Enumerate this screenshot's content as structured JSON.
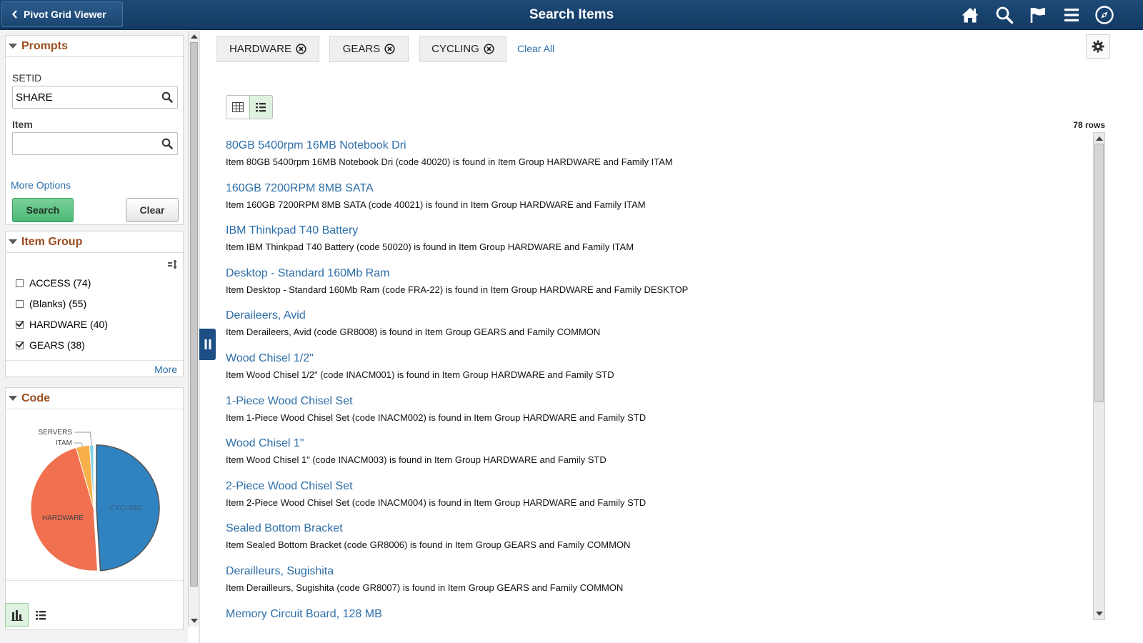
{
  "header": {
    "back_label": "Pivot Grid Viewer",
    "title": "Search Items"
  },
  "prompts": {
    "title": "Prompts",
    "setid_label": "SETID",
    "setid_value": "SHARE",
    "item_label": "Item",
    "item_value": "",
    "more_options": "More Options",
    "search_label": "Search",
    "clear_label": "Clear"
  },
  "item_group": {
    "title": "Item Group",
    "facets": [
      {
        "label": "ACCESS (74)",
        "checked": false
      },
      {
        "label": "(Blanks) (55)",
        "checked": false
      },
      {
        "label": "HARDWARE (40)",
        "checked": true
      },
      {
        "label": "GEARS (38)",
        "checked": true
      }
    ],
    "more": "More"
  },
  "code": {
    "title": "Code",
    "chart_data": {
      "type": "pie",
      "title": "Code",
      "slices": [
        {
          "label": "CYCLING",
          "value": 49,
          "color": "#2f83c0"
        },
        {
          "label": "HARDWARE",
          "value": 46.5,
          "color": "#f07050"
        },
        {
          "label": "ITAM",
          "value": 3.5,
          "color": "#f7b04a"
        },
        {
          "label": "SERVERS",
          "value": 1,
          "color": "#7fd0e2"
        }
      ]
    }
  },
  "filters": {
    "chips": [
      "HARDWARE",
      "GEARS",
      "CYCLING"
    ],
    "clear_all": "Clear All"
  },
  "results": {
    "rows_count": "78 rows",
    "items": [
      {
        "title": "80GB 5400rpm 16MB Notebook Dri",
        "desc": "Item 80GB 5400rpm 16MB Notebook Dri (code 40020) is found in Item Group HARDWARE and Family ITAM"
      },
      {
        "title": "160GB 7200RPM 8MB SATA",
        "desc": "Item 160GB 7200RPM 8MB SATA (code 40021) is found in Item Group HARDWARE and Family ITAM"
      },
      {
        "title": "IBM Thinkpad T40 Battery",
        "desc": "Item IBM Thinkpad T40 Battery (code 50020) is found in Item Group HARDWARE and Family ITAM"
      },
      {
        "title": "Desktop - Standard 160Mb Ram",
        "desc": "Item Desktop - Standard 160Mb Ram (code FRA-22) is found in Item Group HARDWARE and Family DESKTOP"
      },
      {
        "title": "Deraileers, Avid",
        "desc": "Item Deraileers, Avid (code GR8008) is found in Item Group GEARS and Family COMMON"
      },
      {
        "title": "Wood Chisel 1/2\"",
        "desc": "Item Wood Chisel 1/2\" (code INACM001) is found in Item Group HARDWARE and Family STD"
      },
      {
        "title": "1-Piece Wood Chisel Set",
        "desc": "Item 1-Piece Wood Chisel Set (code INACM002) is found in Item Group HARDWARE and Family STD"
      },
      {
        "title": "Wood Chisel 1\"",
        "desc": "Item Wood Chisel 1\" (code INACM003) is found in Item Group HARDWARE and Family STD"
      },
      {
        "title": "2-Piece Wood Chisel Set",
        "desc": "Item 2-Piece Wood Chisel Set (code INACM004) is found in Item Group HARDWARE and Family STD"
      },
      {
        "title": "Sealed Bottom Bracket",
        "desc": "Item Sealed Bottom Bracket (code GR8006) is found in Item Group GEARS and Family COMMON"
      },
      {
        "title": "Derailleurs, Sugishita",
        "desc": "Item Derailleurs, Sugishita (code GR8007) is found in Item Group GEARS and Family COMMON"
      },
      {
        "title": "Memory Circuit Board, 128 MB",
        "desc": ""
      }
    ]
  },
  "icons": {
    "back": "chevron-left-icon",
    "home": "home-icon",
    "search": "search-icon",
    "flag": "flag-icon",
    "menu": "hamburger-menu-icon",
    "navbar": "compass-icon",
    "settings": "gear-icon"
  }
}
